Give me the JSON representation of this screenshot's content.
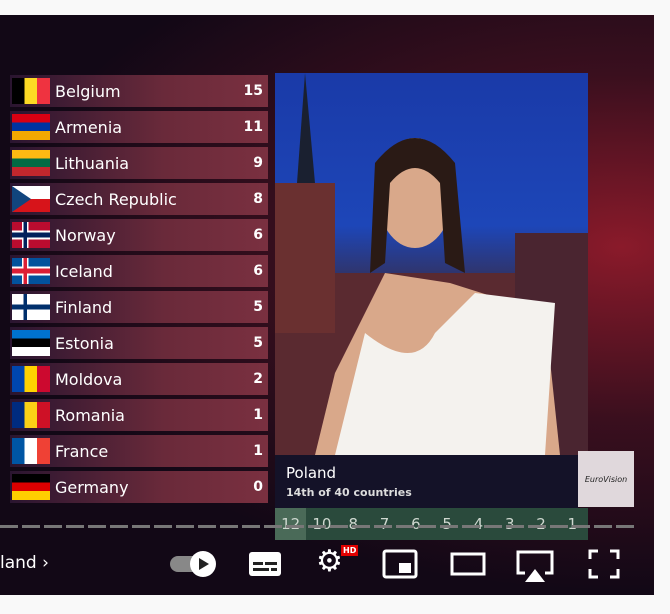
{
  "scoreboard": [
    {
      "country": "Belgium",
      "points": "15",
      "flag": [
        "#000000",
        "#fdda24",
        "#ef3340"
      ],
      "dir": "v"
    },
    {
      "country": "Armenia",
      "points": "11",
      "flag": [
        "#d90012",
        "#0033a0",
        "#f2a800"
      ],
      "dir": "h"
    },
    {
      "country": "Lithuania",
      "points": "9",
      "flag": [
        "#fdb913",
        "#006a44",
        "#c1272d"
      ],
      "dir": "h"
    },
    {
      "country": "Czech Republic",
      "points": "8",
      "flag": [
        "#ffffff",
        "#d7141a",
        "#11457e"
      ],
      "dir": "cz"
    },
    {
      "country": "Norway",
      "points": "6",
      "flag": [
        "#ba0c2f",
        "#ffffff",
        "#00205b"
      ],
      "dir": "nordic"
    },
    {
      "country": "Iceland",
      "points": "6",
      "flag": [
        "#02529c",
        "#ffffff",
        "#dc1e35"
      ],
      "dir": "nordic"
    },
    {
      "country": "Finland",
      "points": "5",
      "flag": [
        "#ffffff",
        "#ffffff",
        "#002f6c"
      ],
      "dir": "nordic"
    },
    {
      "country": "Estonia",
      "points": "5",
      "flag": [
        "#0072ce",
        "#000000",
        "#ffffff"
      ],
      "dir": "h"
    },
    {
      "country": "Moldova",
      "points": "2",
      "flag": [
        "#0046ae",
        "#ffd200",
        "#cc092f"
      ],
      "dir": "v"
    },
    {
      "country": "Romania",
      "points": "1",
      "flag": [
        "#002b7f",
        "#fcd116",
        "#ce1126"
      ],
      "dir": "v"
    },
    {
      "country": "France",
      "points": "1",
      "flag": [
        "#0055a4",
        "#ffffff",
        "#ef4135"
      ],
      "dir": "v"
    },
    {
      "country": "Germany",
      "points": "0",
      "flag": [
        "#000000",
        "#dd0000",
        "#ffce00"
      ],
      "dir": "h"
    }
  ],
  "voting": {
    "country": "Poland",
    "rank": "14th of 40 countries",
    "points": [
      "12",
      "10",
      "8",
      "7",
      "6",
      "5",
      "4",
      "3",
      "2",
      "1"
    ],
    "active": "12"
  },
  "logo_text": "EuroVision Song Contest",
  "controls": {
    "next_label": "land",
    "hd_badge": "HD",
    "hd_color": "#e00000"
  }
}
